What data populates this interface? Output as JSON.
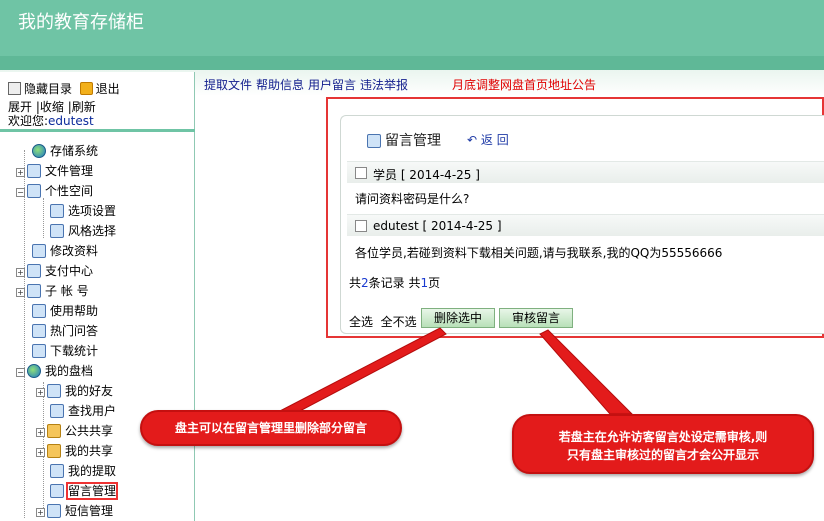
{
  "app_title": "我的教育存储柜",
  "topbar": {
    "links": [
      "提取文件",
      "帮助信息",
      "用户留言",
      "违法举报"
    ],
    "announcement": "月底调整网盘首页地址公告"
  },
  "sidebar": {
    "hide_menu": "隐藏目录",
    "logout": "退出",
    "expand": "展开",
    "collapse": "收缩",
    "refresh": "刷新",
    "welcome": "欢迎您:",
    "username": "edutest",
    "tree": [
      {
        "label": "存储系统"
      },
      {
        "label": "文件管理"
      },
      {
        "label": "个性空间"
      },
      {
        "label": "选项设置"
      },
      {
        "label": "风格选择"
      },
      {
        "label": "修改资料"
      },
      {
        "label": "支付中心"
      },
      {
        "label": "子 帐 号"
      },
      {
        "label": "使用帮助"
      },
      {
        "label": "热门问答"
      },
      {
        "label": "下载统计"
      },
      {
        "label": "我的盘档"
      },
      {
        "label": "我的好友"
      },
      {
        "label": "查找用户"
      },
      {
        "label": "公共共享"
      },
      {
        "label": "我的共享"
      },
      {
        "label": "我的提取"
      },
      {
        "label": "留言管理"
      },
      {
        "label": "短信管理"
      }
    ]
  },
  "main": {
    "title": "留言管理",
    "back": "返 回",
    "messages": [
      {
        "header": "学员 [ 2014-4-25 ]",
        "body": "请问资料密码是什么?"
      },
      {
        "header": "edutest [ 2014-4-25 ]",
        "body": "各位学员,若碰到资料下载相关问题,请与我联系,我的QQ为55556666"
      }
    ],
    "total_prefix": "共",
    "total_count": "2",
    "total_mid": "条记录 共",
    "total_pages": "1",
    "total_suffix": "页",
    "select_all": "全选",
    "select_none": "全不选",
    "delete_selected": "删除选中",
    "approve": "审核留言"
  },
  "callouts": {
    "left": "盘主可以在留言管理里删除部分留言",
    "right_line1": "若盘主在允许访客留言处设定需审核,则",
    "right_line2": "只有盘主审核过的留言才会公开显示"
  },
  "colors": {
    "header_bg": "#6fc4a5",
    "accent_red": "#e31b1b",
    "link_blue": "#14208e"
  }
}
